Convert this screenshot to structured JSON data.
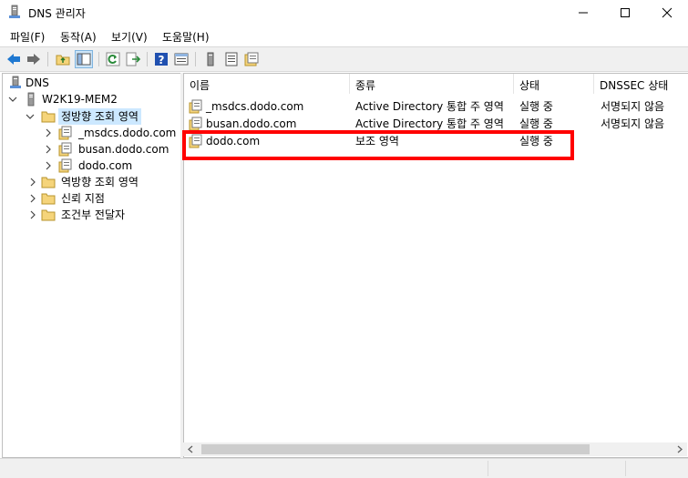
{
  "window": {
    "title": "DNS 관리자"
  },
  "menu": [
    "파일(F)",
    "동작(A)",
    "보기(V)",
    "도움말(H)"
  ],
  "tree": {
    "root": "DNS",
    "server": "W2K19-MEM2",
    "forward_zones": "정방향 조회 영역",
    "zones": [
      "_msdcs.dodo.com",
      "busan.dodo.com",
      "dodo.com"
    ],
    "reverse_zones": "역방향 조회 영역",
    "trust_points": "신뢰 지점",
    "conditional_forwarders": "조건부 전달자"
  },
  "list": {
    "columns": [
      "이름",
      "종류",
      "상태",
      "DNSSEC 상태"
    ],
    "rows": [
      {
        "name": "_msdcs.dodo.com",
        "type": "Active Directory 통합 주 영역",
        "status": "실행 중",
        "dnssec": "서명되지 않음"
      },
      {
        "name": "busan.dodo.com",
        "type": "Active Directory 통합 주 영역",
        "status": "실행 중",
        "dnssec": "서명되지 않음"
      },
      {
        "name": "dodo.com",
        "type": "보조 영역",
        "status": "실행 중",
        "dnssec": ""
      }
    ]
  },
  "colors": {
    "highlight": "#ff0000",
    "selection": "#cce8ff",
    "folder": "#f5d47a",
    "back_arrow": "#1f78d1"
  }
}
